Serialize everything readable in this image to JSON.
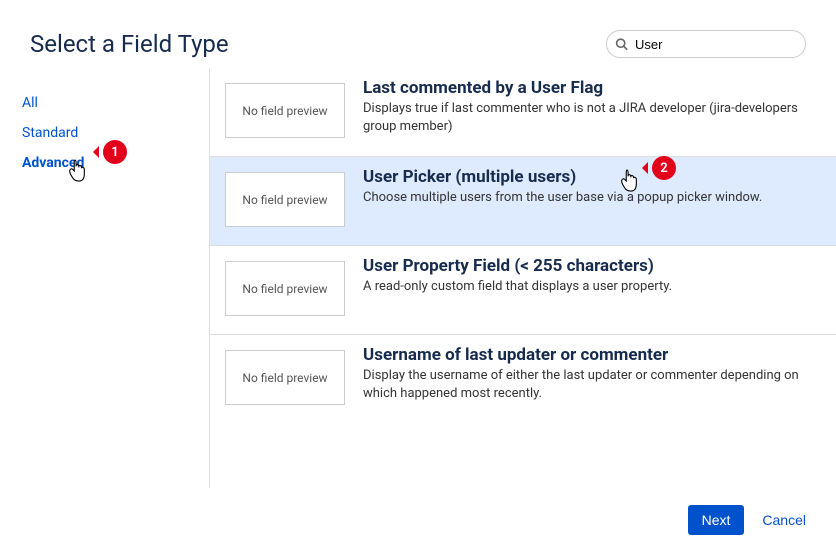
{
  "header": {
    "title": "Select a Field Type",
    "search_value": "User"
  },
  "sidebar": {
    "items": [
      {
        "label": "All",
        "active": false
      },
      {
        "label": "Standard",
        "active": false
      },
      {
        "label": "Advanced",
        "active": true
      }
    ]
  },
  "preview_placeholder": "No field preview",
  "fields": [
    {
      "title": "Last commented by a User Flag",
      "desc": "Displays true if last commenter who is not a JIRA developer (jira-developers group member)",
      "selected": false
    },
    {
      "title": "User Picker (multiple users)",
      "desc": "Choose multiple users from the user base via a popup picker window.",
      "selected": true
    },
    {
      "title": "User Property Field (< 255 characters)",
      "desc": "A read-only custom field that displays a user property.",
      "selected": false
    },
    {
      "title": "Username of last updater or commenter",
      "desc": "Display the username of either the last updater or commenter depending on which happened most recently.",
      "selected": false
    }
  ],
  "footer": {
    "next_label": "Next",
    "cancel_label": "Cancel"
  },
  "callouts": {
    "one": "1",
    "two": "2"
  }
}
